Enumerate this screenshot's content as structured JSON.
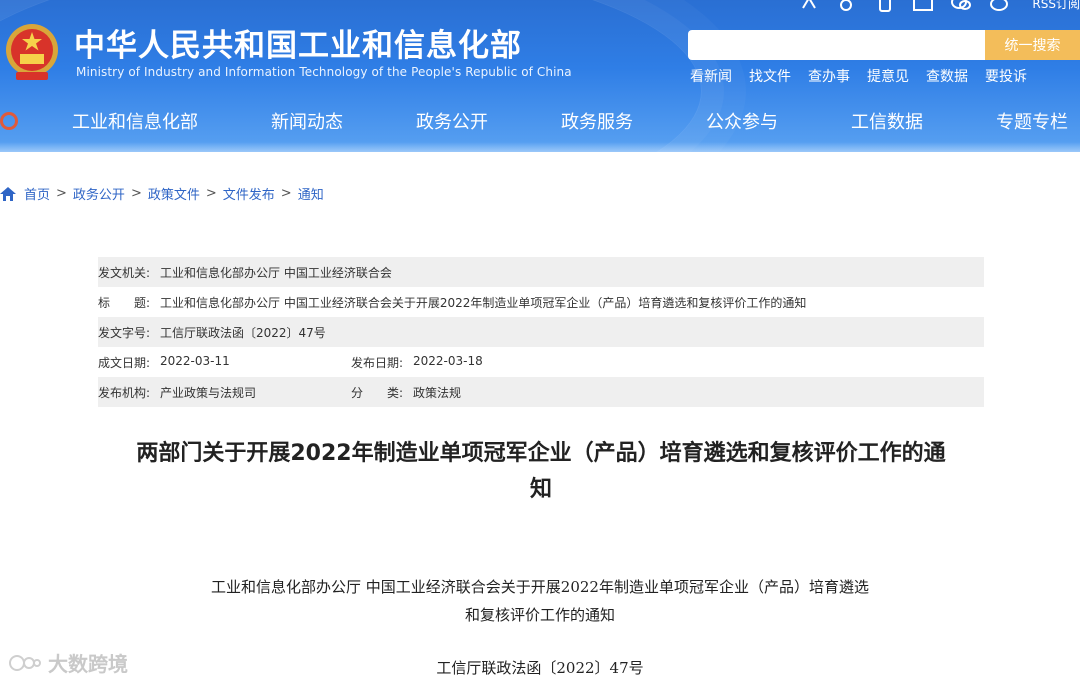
{
  "header": {
    "title_cn": "中华人民共和国工业和信息化部",
    "title_en": "Ministry of Industry and Information Technology of the People's Republic of China",
    "rss_label": "RSS订阅",
    "search": {
      "placeholder": "",
      "button": "统一搜索"
    },
    "quick_links": [
      "看新闻",
      "找文件",
      "查办事",
      "提意见",
      "查数据",
      "要投诉"
    ],
    "nav": [
      "工业和信息化部",
      "新闻动态",
      "政务公开",
      "政务服务",
      "公众参与",
      "工信数据",
      "专题专栏"
    ]
  },
  "breadcrumb": [
    "首页",
    "政务公开",
    "政策文件",
    "文件发布",
    "通知"
  ],
  "meta": {
    "issuer_label": "发文机关:",
    "issuer": "工业和信息化部办公厅 中国工业经济联合会",
    "title_label": "标　　题:",
    "title": "工业和信息化部办公厅 中国工业经济联合会关于开展2022年制造业单项冠军企业（产品）培育遴选和复核评价工作的通知",
    "docno_label": "发文字号:",
    "docno": "工信厅联政法函〔2022〕47号",
    "written_label": "成文日期:",
    "written": "2022-03-11",
    "published_label": "发布日期:",
    "published": "2022-03-18",
    "agency_label": "发布机构:",
    "agency": "产业政策与法规司",
    "category_label": "分　　类:",
    "category": "政策法规"
  },
  "article": {
    "heading_line1": "两部门关于开展2022年制造业单项冠军企业（产品）培育遴选和复核评价工作的通",
    "heading_line2": "知",
    "subtitle_line1": "工业和信息化部办公厅 中国工业经济联合会关于开展2022年制造业单项冠军企业（产品）培育遴选",
    "subtitle_line2": "和复核评价工作的通知",
    "doc_number": "工信厅联政法函〔2022〕47号"
  },
  "watermark": "大数跨境",
  "colors": {
    "header_blue": "#2f7ee6",
    "search_button": "#f3bd5a",
    "link_blue": "#2f65c6"
  }
}
